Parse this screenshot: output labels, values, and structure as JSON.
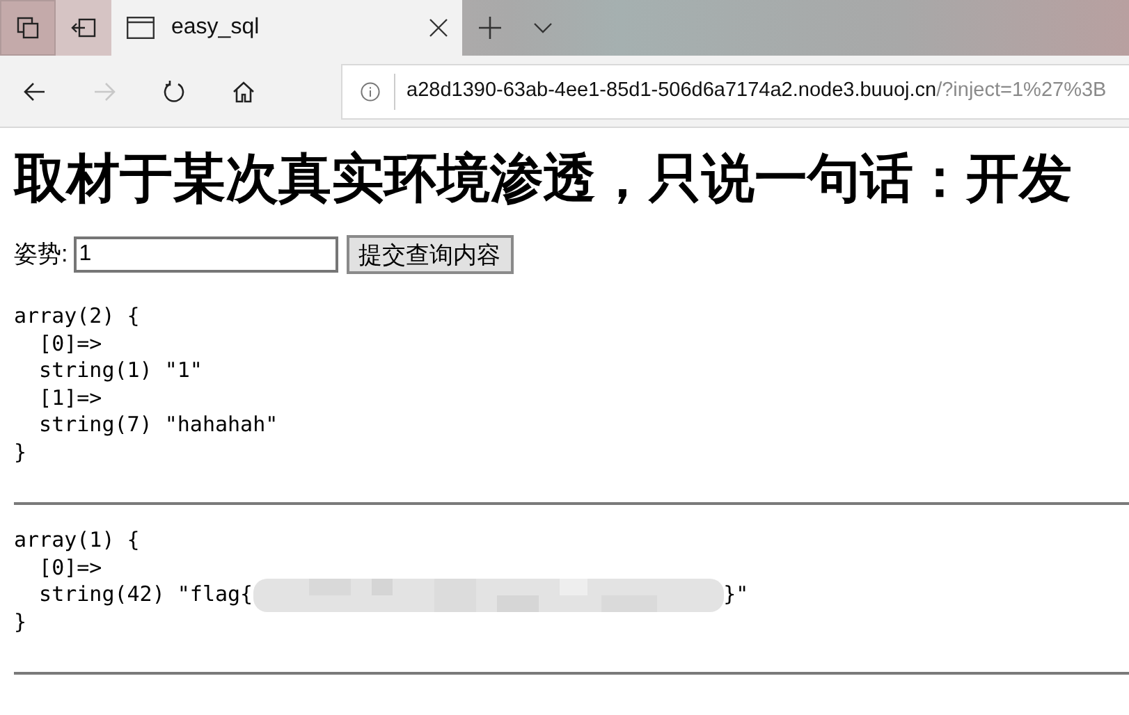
{
  "tabs": [
    {
      "title": "easy_sql",
      "selected": true
    }
  ],
  "nav": [
    {
      "kind": "back",
      "disabled": false
    },
    {
      "kind": "forward",
      "disabled": true
    },
    {
      "kind": "refresh",
      "disabled": false
    },
    {
      "kind": "home",
      "disabled": false
    }
  ],
  "address": {
    "host": "a28d1390-63ab-4ee1-85d1-506d6a7174a2.node3.buuoj.cn",
    "path": "/?inject=1%27%3B"
  },
  "heading": "取材于某次真实环境渗透，只说一句话：开发",
  "form": {
    "label": "姿势:",
    "value": "1",
    "button": "提交查询内容"
  },
  "dumps": [
    {
      "lines": [
        {
          "kind": "text",
          "text": "array(2) {"
        },
        {
          "kind": "text",
          "text": "  [0]=>"
        },
        {
          "kind": "text",
          "text": "  string(1) \"1\""
        },
        {
          "kind": "text",
          "text": "  [1]=>"
        },
        {
          "kind": "text",
          "text": "  string(7) \"hahahah\""
        },
        {
          "kind": "text",
          "text": "}"
        }
      ]
    },
    {
      "lines": [
        {
          "kind": "text",
          "text": "array(1) {"
        },
        {
          "kind": "text",
          "text": "  [0]=>"
        },
        {
          "kind": "redacted",
          "before": "  string(42) \"flag{",
          "after": "}\""
        },
        {
          "kind": "text",
          "text": "}"
        }
      ]
    }
  ]
}
